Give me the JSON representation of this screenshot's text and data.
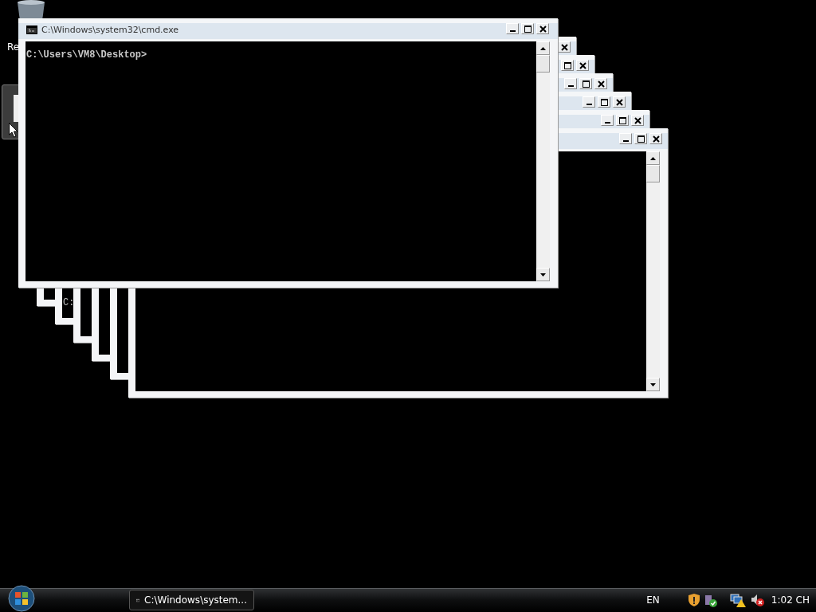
{
  "desktop": {
    "icons": [
      {
        "label": "Re"
      }
    ],
    "ghost_text": "C:"
  },
  "ghost_windows": [
    {
      "kind": "frame"
    },
    {
      "kind": "frame"
    },
    {
      "kind": "frame"
    },
    {
      "kind": "frame"
    },
    {
      "kind": "frame"
    },
    {
      "kind": "frame"
    }
  ],
  "window": {
    "title": "C:\\Windows\\system32\\cmd.exe",
    "lines": [
      "C:\\Users\\VM8\\Desktop>"
    ]
  },
  "taskbar": {
    "tasks": [
      {
        "label": "C:\\Windows\\system...",
        "selected": false
      }
    ],
    "language": "EN",
    "clock": "1:02 CH"
  }
}
